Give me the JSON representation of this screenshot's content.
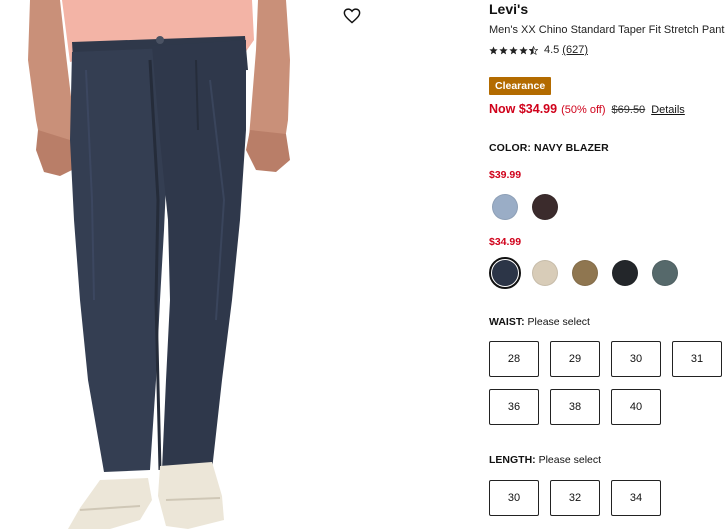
{
  "product": {
    "brand": "Levi's",
    "name": "Men's XX Chino Standard Taper Fit Stretch Pants",
    "rating": {
      "stars_filled": 4.5,
      "value": "4.5",
      "count": "(627)"
    },
    "badge": "Clearance",
    "price": {
      "now": "Now $34.99",
      "discount": "(50% off)",
      "original": "$69.50",
      "details_label": "Details"
    }
  },
  "color": {
    "label": "COLOR: NAVY BLAZER",
    "tiers": [
      {
        "price": "$39.99",
        "swatches": [
          {
            "name": "light-blue",
            "color": "#9aadc6",
            "selected": false
          },
          {
            "name": "dark-brown",
            "color": "#3b2b2c",
            "selected": false
          }
        ]
      },
      {
        "price": "$34.99",
        "swatches": [
          {
            "name": "navy-blazer",
            "color": "#2c3547",
            "selected": true
          },
          {
            "name": "khaki",
            "color": "#d8ccb8",
            "selected": false
          },
          {
            "name": "olive-tan",
            "color": "#8f7650",
            "selected": false
          },
          {
            "name": "black",
            "color": "#23262a",
            "selected": false
          },
          {
            "name": "slate-teal",
            "color": "#56696b",
            "selected": false
          }
        ]
      }
    ]
  },
  "waist": {
    "label": "WAIST:",
    "prompt": "Please select",
    "sizes": [
      "28",
      "29",
      "30",
      "31",
      "36",
      "38",
      "40"
    ]
  },
  "length": {
    "label": "LENGTH:",
    "prompt": "Please select",
    "sizes": [
      "30",
      "32",
      "34"
    ]
  },
  "icons": {
    "favorite": "heart-outline-icon",
    "rating": "star-icon"
  },
  "colors": {
    "sale_red": "#d0021b",
    "clearance_badge": "#b36b00",
    "pants_navy": "#333d50"
  }
}
